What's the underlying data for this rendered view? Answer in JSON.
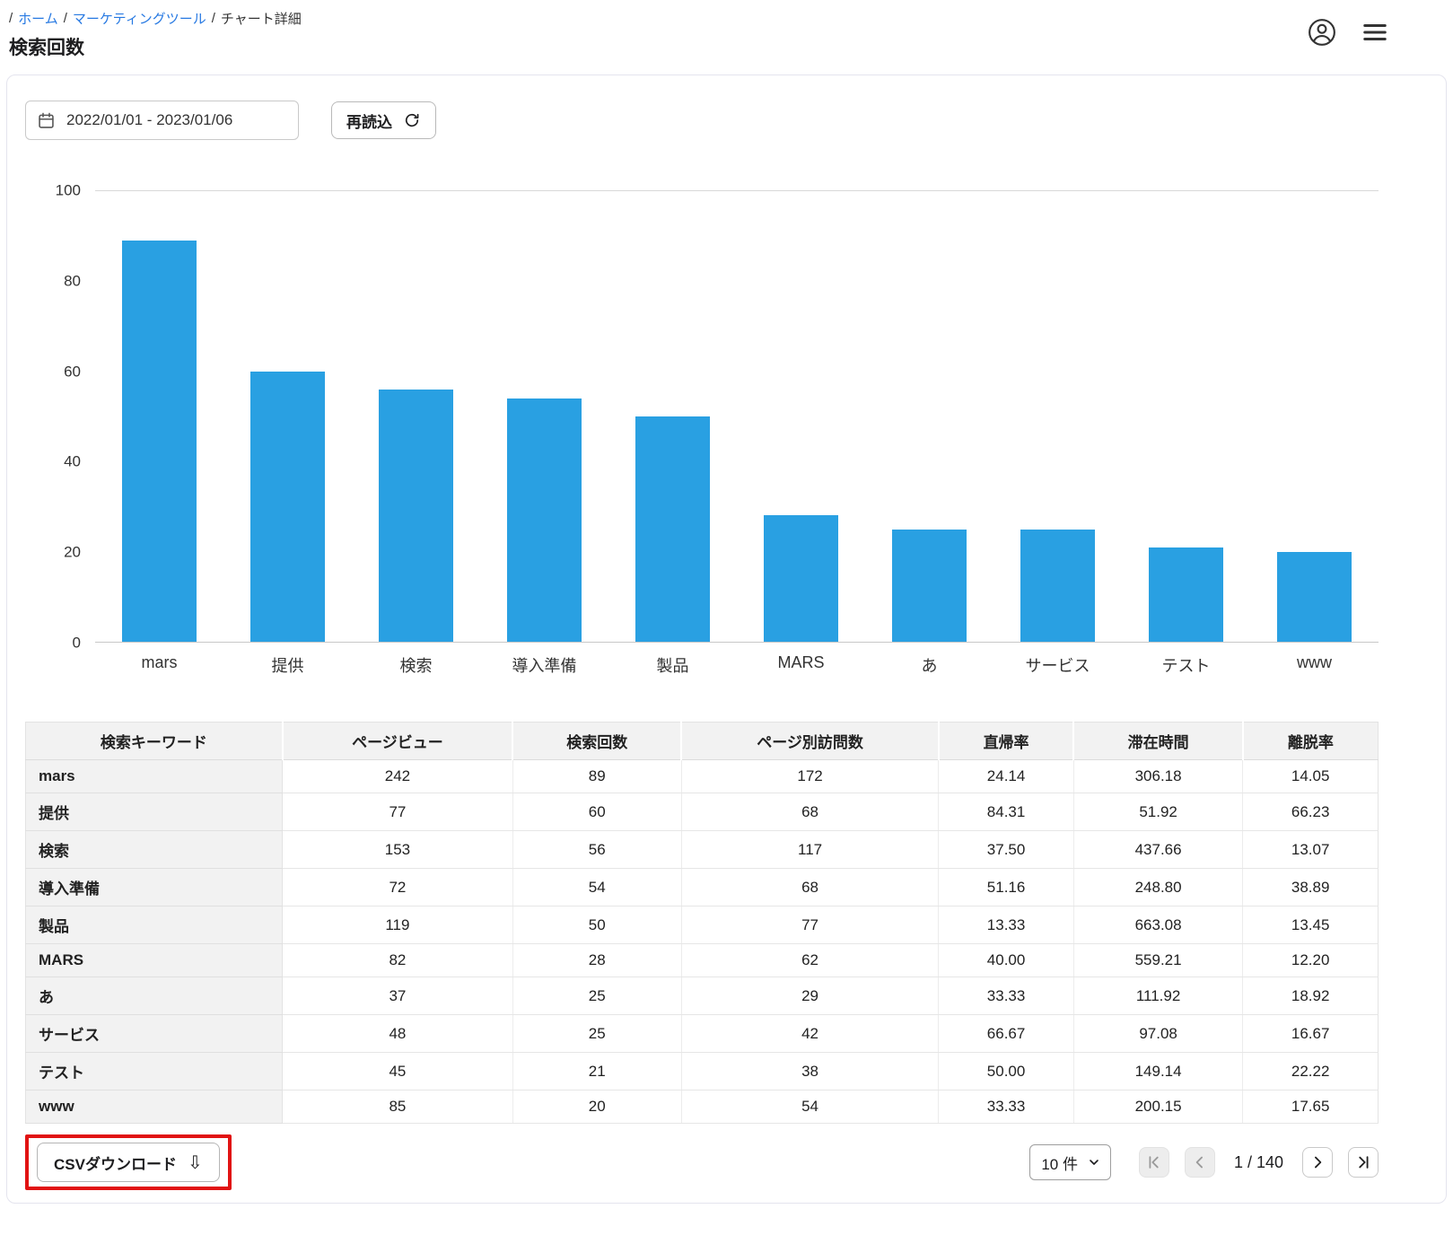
{
  "breadcrumb": {
    "separator": "/",
    "items": [
      {
        "label": "ホーム",
        "link": true
      },
      {
        "label": "マーケティングツール",
        "link": true
      },
      {
        "label": "チャート詳細",
        "link": false
      }
    ]
  },
  "page_title": "検索回数",
  "toolbar": {
    "date_range": "2022/01/01  -  2023/01/06",
    "reload_label": "再読込"
  },
  "chart_data": {
    "type": "bar",
    "title": "",
    "xlabel": "",
    "ylabel": "",
    "series_name": "検索回数",
    "categories": [
      "mars",
      "提供",
      "検索",
      "導入準備",
      "製品",
      "MARS",
      "あ",
      "サービス",
      "テスト",
      "www"
    ],
    "values": [
      89,
      60,
      56,
      54,
      50,
      28,
      25,
      25,
      21,
      20
    ],
    "ylim": [
      0,
      100
    ],
    "yticks": [
      0,
      20,
      40,
      60,
      80,
      100
    ],
    "bar_color": "#29a0e2",
    "grid": "line at top (100) and baseline (0) only",
    "legend": "none"
  },
  "table": {
    "headers": [
      "検索キーワード",
      "ページビュー",
      "検索回数",
      "ページ別訪問数",
      "直帰率",
      "滞在時間",
      "離脱率"
    ],
    "rows": [
      [
        "mars",
        "242",
        "89",
        "172",
        "24.14",
        "306.18",
        "14.05"
      ],
      [
        "提供",
        "77",
        "60",
        "68",
        "84.31",
        "51.92",
        "66.23"
      ],
      [
        "検索",
        "153",
        "56",
        "117",
        "37.50",
        "437.66",
        "13.07"
      ],
      [
        "導入準備",
        "72",
        "54",
        "68",
        "51.16",
        "248.80",
        "38.89"
      ],
      [
        "製品",
        "119",
        "50",
        "77",
        "13.33",
        "663.08",
        "13.45"
      ],
      [
        "MARS",
        "82",
        "28",
        "62",
        "40.00",
        "559.21",
        "12.20"
      ],
      [
        "あ",
        "37",
        "25",
        "29",
        "33.33",
        "111.92",
        "18.92"
      ],
      [
        "サービス",
        "48",
        "25",
        "42",
        "66.67",
        "97.08",
        "16.67"
      ],
      [
        "テスト",
        "45",
        "21",
        "38",
        "50.00",
        "149.14",
        "22.22"
      ],
      [
        "www",
        "85",
        "20",
        "54",
        "33.33",
        "200.15",
        "17.65"
      ]
    ]
  },
  "footer": {
    "csv_button_label": "CSVダウンロード",
    "page_size_value": "10 件",
    "page_indicator": "1 / 140"
  },
  "icons": {
    "download_glyph": "⇩"
  },
  "colors": {
    "bar": "#29a0e2",
    "link": "#2779e2",
    "annotation_red": "#e11212",
    "header_bg": "#f2f2f2"
  }
}
